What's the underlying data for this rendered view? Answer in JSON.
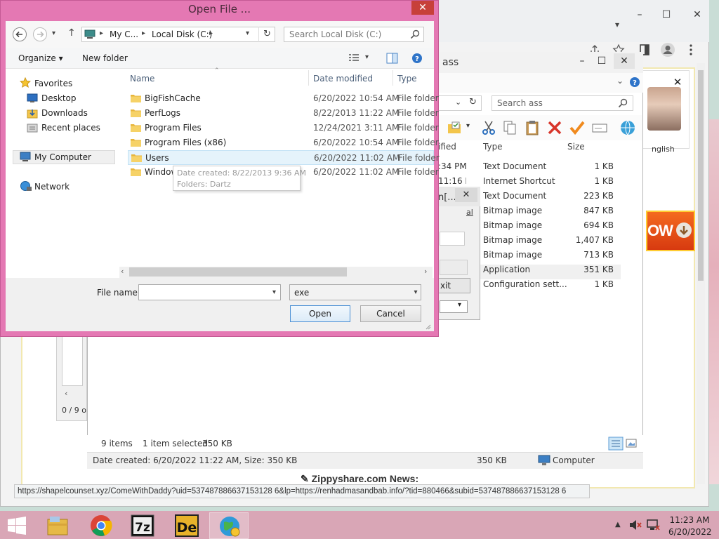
{
  "dialog": {
    "title": "Open File ...",
    "close_glyph": "✕",
    "nav": {
      "back_glyph": "←",
      "forward_glyph": "→",
      "recent_glyph": "▾",
      "up_glyph": "↑",
      "address": [
        "My C...",
        "Local Disk (C:)"
      ],
      "address_sep": "▸",
      "refresh_glyph": "↻",
      "search_placeholder": "Search Local Disk (C:)"
    },
    "commands": {
      "organize": "Organize ▾",
      "new_folder": "New folder",
      "view_drop": "▾"
    },
    "nav_pane": {
      "favorites": "Favorites",
      "desktop": "Desktop",
      "downloads": "Downloads",
      "recent_places": "Recent places",
      "my_computer": "My Computer",
      "network": "Network"
    },
    "columns": {
      "name": "Name",
      "date": "Date modified",
      "type": "Type"
    },
    "files": [
      {
        "name": "BigFishCache",
        "date": "6/20/2022 10:54 AM",
        "type": "File folder"
      },
      {
        "name": "PerfLogs",
        "date": "8/22/2013 11:22 AM",
        "type": "File folder"
      },
      {
        "name": "Program Files",
        "date": "12/24/2021 3:11 AM",
        "type": "File folder"
      },
      {
        "name": "Program Files (x86)",
        "date": "6/20/2022 10:54 AM",
        "type": "File folder"
      },
      {
        "name": "Users",
        "date": "6/20/2022 11:02 AM",
        "type": "File folder"
      },
      {
        "name": "Windows",
        "date": "6/20/2022 11:02 AM",
        "type": "File folder"
      }
    ],
    "tooltip": {
      "line1": "Date created: 8/22/2013 9:36 AM",
      "line2": "Folders: Dartz"
    },
    "file_name_label": "File name:",
    "file_name_value": "",
    "filter_value": "exe",
    "dropdown_glyph": "▾",
    "open_label": "Open",
    "cancel_label": "Cancel"
  },
  "explorer": {
    "title": "ass",
    "search_placeholder": "Search ass",
    "columns": {
      "modified": "ified",
      "type": "Type",
      "size": "Size"
    },
    "rows": [
      {
        "mod": ":34 PM",
        "type": "Text Document",
        "size": "1 KB"
      },
      {
        "mod": "11:16 PM",
        "type": "Internet Shortcut",
        "size": "1 KB"
      },
      {
        "mod": "",
        "type": "Text Document",
        "size": "223 KB"
      },
      {
        "mod": "",
        "type": "Bitmap image",
        "size": "847 KB"
      },
      {
        "mod": "",
        "type": "Bitmap image",
        "size": "694 KB"
      },
      {
        "mod": "",
        "type": "Bitmap image",
        "size": "1,407 KB"
      },
      {
        "mod": "",
        "type": "Bitmap image",
        "size": "713 KB"
      },
      {
        "mod": "",
        "type": "Application",
        "size": "351 KB"
      },
      {
        "mod": "",
        "type": "Configuration sett...",
        "size": "1 KB"
      }
    ],
    "status_items": "9 items",
    "status_selected": "1 item selected",
    "status_size": "350 KB",
    "details": "Date created: 6/20/2022 11:22 AM, Size: 350 KB",
    "details_size": "350 KB",
    "details_location": "Computer"
  },
  "mini_dialog": {
    "title_frag": "n[...",
    "button_frag": "xit",
    "label_frag": "al"
  },
  "browser": {
    "status_url": "https://shapelcounset.xyz/ComeWithDaddy?uid=537487886637153128 6&lp=https://renhadmasandbab.info/?tid=880466&subid=537487886637153128 6",
    "news": "Zippyshare.com News:",
    "page_left_frag": "0 / 9 o",
    "ad_lang_frag": "nglish",
    "ad_button": "OW",
    "win_min": "–",
    "win_max": "☐",
    "win_close": "✕",
    "scroll_down": "▾"
  },
  "taskbar": {
    "time": "11:23 AM",
    "date": "6/20/2022",
    "apps": [
      "file-explorer",
      "chrome",
      "7-zip",
      "de-app",
      "globe-app"
    ],
    "colors": {
      "taskbar": "#d9a6b6",
      "dialog_frame": "#e478b3",
      "selection": "#e5f3fb"
    }
  }
}
